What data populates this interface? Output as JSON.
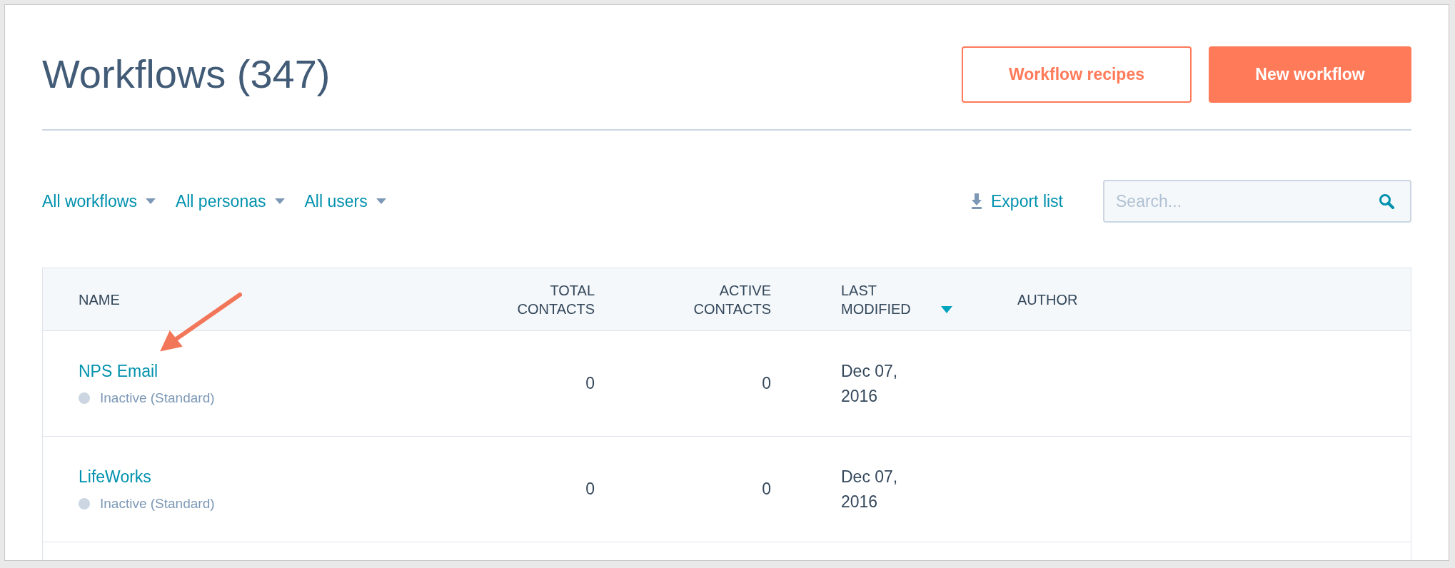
{
  "title": "Workflows (347)",
  "buttons": [
    {
      "label": "Workflow recipes",
      "kind": "secondary"
    },
    {
      "label": "New workflow",
      "kind": "primary"
    }
  ],
  "filters": [
    {
      "label": "All workflows"
    },
    {
      "label": "All personas"
    },
    {
      "label": "All users"
    }
  ],
  "export": {
    "label": "Export list"
  },
  "search": {
    "placeholder": "Search..."
  },
  "table": {
    "columns": [
      {
        "label": "NAME",
        "kind": "text",
        "sorted": false
      },
      {
        "label": "TOTAL CONTACTS",
        "kind": "number",
        "sorted": false
      },
      {
        "label": "ACTIVE CONTACTS",
        "kind": "number",
        "sorted": false
      },
      {
        "label": "LAST MODIFIED",
        "kind": "text",
        "sorted": true
      },
      {
        "label": "AUTHOR",
        "kind": "text",
        "sorted": false
      }
    ],
    "rows": [
      {
        "name": "NPS Email",
        "status": "Inactive (Standard)",
        "color": "#cbd6e2",
        "total": "0",
        "active": "0",
        "modified": "Dec 07, 2016",
        "annotated": true
      },
      {
        "name": "LifeWorks",
        "status": "Inactive (Standard)",
        "color": "#cbd6e2",
        "total": "0",
        "active": "0",
        "modified": "Dec 07, 2016",
        "annotated": false
      }
    ]
  }
}
